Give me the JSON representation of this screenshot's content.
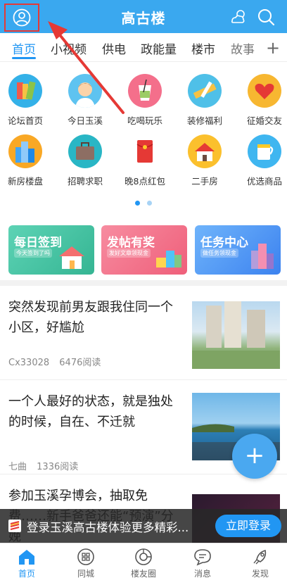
{
  "header": {
    "title": "高古楼"
  },
  "tabs": [
    {
      "label": "首页"
    },
    {
      "label": "小视频"
    },
    {
      "label": "供电"
    },
    {
      "label": "政能量"
    },
    {
      "label": "楼市"
    },
    {
      "label": "故事"
    }
  ],
  "grid": [
    {
      "label": "论坛首页",
      "icon": "books-icon"
    },
    {
      "label": "今日玉溪",
      "icon": "person-icon"
    },
    {
      "label": "吃喝玩乐",
      "icon": "drink-icon"
    },
    {
      "label": "装修福利",
      "icon": "ruler-icon"
    },
    {
      "label": "征婚交友",
      "icon": "heart-icon"
    },
    {
      "label": "新房楼盘",
      "icon": "buildings-icon"
    },
    {
      "label": "招聘求职",
      "icon": "briefcase-icon"
    },
    {
      "label": "晚8点红包",
      "icon": "red-envelope-icon"
    },
    {
      "label": "二手房",
      "icon": "house-icon"
    },
    {
      "label": "优选商品",
      "icon": "cup-icon"
    }
  ],
  "cards": [
    {
      "title": "每日签到",
      "subtitle": "今天签到了吗",
      "color": "#43c3a4"
    },
    {
      "title": "发帖有奖",
      "subtitle": "发好文章领现金",
      "color": "#f0637a"
    },
    {
      "title": "任务中心",
      "subtitle": "做任务领现金",
      "color": "#3f8ff2"
    }
  ],
  "feed": [
    {
      "title": "突然发现前男友跟我住同一个小区，好尴尬",
      "author": "Cx33028",
      "reads": "6476阅读"
    },
    {
      "title": "一个人最好的状态，就是独处的时候，自在、不迁就",
      "author": "七曲",
      "reads": "1336阅读"
    },
    {
      "title": "参加玉溪孕博会，抽取免费……新手爸爸还能“预演”分娩",
      "author": "",
      "reads": ""
    }
  ],
  "login_banner": {
    "text": "登录玉溪高古楼体验更多精彩...",
    "button": "立即登录"
  },
  "bottom_nav": [
    {
      "label": "首页"
    },
    {
      "label": "同城"
    },
    {
      "label": "楼友圈"
    },
    {
      "label": "消息"
    },
    {
      "label": "发现"
    }
  ],
  "colors": {
    "primary": "#2196f3",
    "header": "#3aa8ef",
    "annotation": "#e53935"
  }
}
